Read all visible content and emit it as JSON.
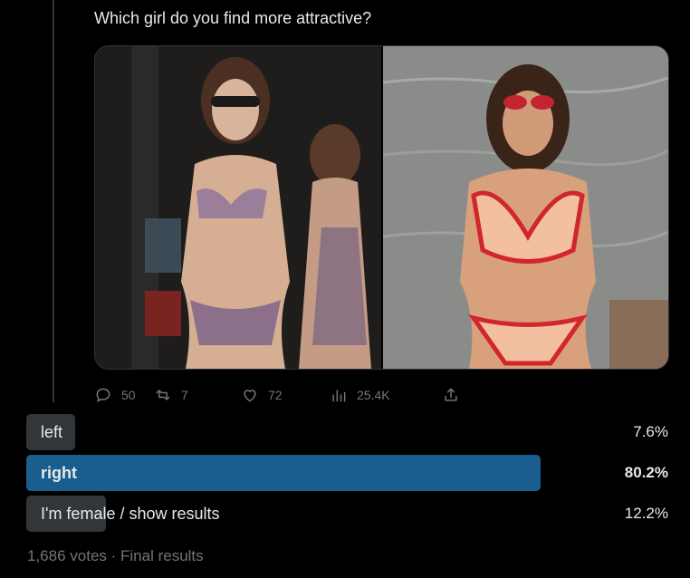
{
  "tweet": {
    "question": "Which girl do you find more attractive?"
  },
  "metrics": {
    "replies": "50",
    "reposts": "7",
    "likes": "72",
    "views": "25.4K"
  },
  "poll": {
    "options": [
      {
        "label": "left",
        "percent": "7.6%",
        "fraction": 0.076,
        "winner": false
      },
      {
        "label": "right",
        "percent": "80.2%",
        "fraction": 0.802,
        "winner": true
      },
      {
        "label": "I'm female / show results",
        "percent": "12.2%",
        "fraction": 0.122,
        "winner": false
      }
    ],
    "footer": "1,686 votes · Final results"
  },
  "icons": [
    "reply-icon",
    "repost-icon",
    "like-icon",
    "views-icon",
    "share-icon"
  ],
  "colors": {
    "background": "#000000",
    "winner_bar": "#1a5e90",
    "other_bar": "#333639",
    "muted_text": "#71767b"
  }
}
